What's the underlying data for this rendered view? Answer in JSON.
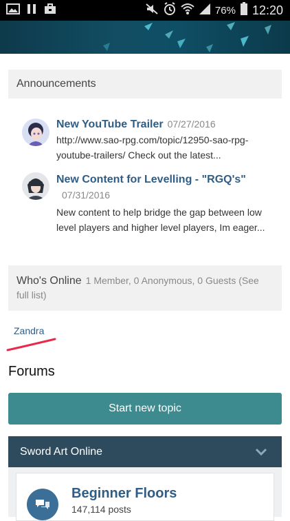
{
  "status_bar": {
    "battery": "76%",
    "time": "12:20"
  },
  "announcements": {
    "heading": "Announcements",
    "items": [
      {
        "title": "New YouTube Trailer",
        "date": "07/27/2016",
        "desc": "http://www.sao-rpg.com/topic/12950-sao-rpg-youtube-trailers/ Check out the latest..."
      },
      {
        "title": "New Content for Levelling - \"RGQ's\"",
        "date": "07/31/2016",
        "desc": "New content to help bridge the gap between low level players and higher level players, Im eager..."
      }
    ]
  },
  "online": {
    "label": "Who's Online",
    "counts": "1 Member, 0 Anonymous, 0 Guests (See full list)",
    "members": [
      "Zandra"
    ]
  },
  "forums": {
    "heading": "Forums",
    "start_topic": "Start new topic",
    "category": "Sword Art Online",
    "forum": {
      "title": "Beginner Floors",
      "posts": "147,114 posts"
    }
  },
  "colors": {
    "link": "#2f5d86",
    "button": "#3d8a8f",
    "category": "#2e4b5e",
    "annotation": "#e8294a"
  }
}
